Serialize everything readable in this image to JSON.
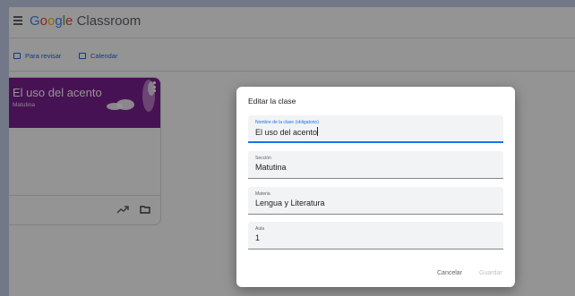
{
  "app": {
    "logo_google": [
      "G",
      "o",
      "o",
      "g",
      "l",
      "e"
    ],
    "logo_product": "Classroom"
  },
  "nav": {
    "review_label": "Para revisar",
    "calendar_label": "Calendar"
  },
  "card": {
    "title": "El uso del acento",
    "section": "Matutina",
    "header_color": "#7b1f8f"
  },
  "dialog": {
    "title": "Editar la clase",
    "fields": [
      {
        "label": "Nombre de la clase (obligatorio)",
        "value": "El uso del acento"
      },
      {
        "label": "Sección",
        "value": "Matutina"
      },
      {
        "label": "Materia",
        "value": "Lengua y Literatura"
      },
      {
        "label": "Aula",
        "value": "1"
      }
    ],
    "cancel_label": "Cancelar",
    "save_label": "Guardar"
  },
  "colors": {
    "accent": "#1a73e8",
    "background": "#c5cfe9"
  }
}
